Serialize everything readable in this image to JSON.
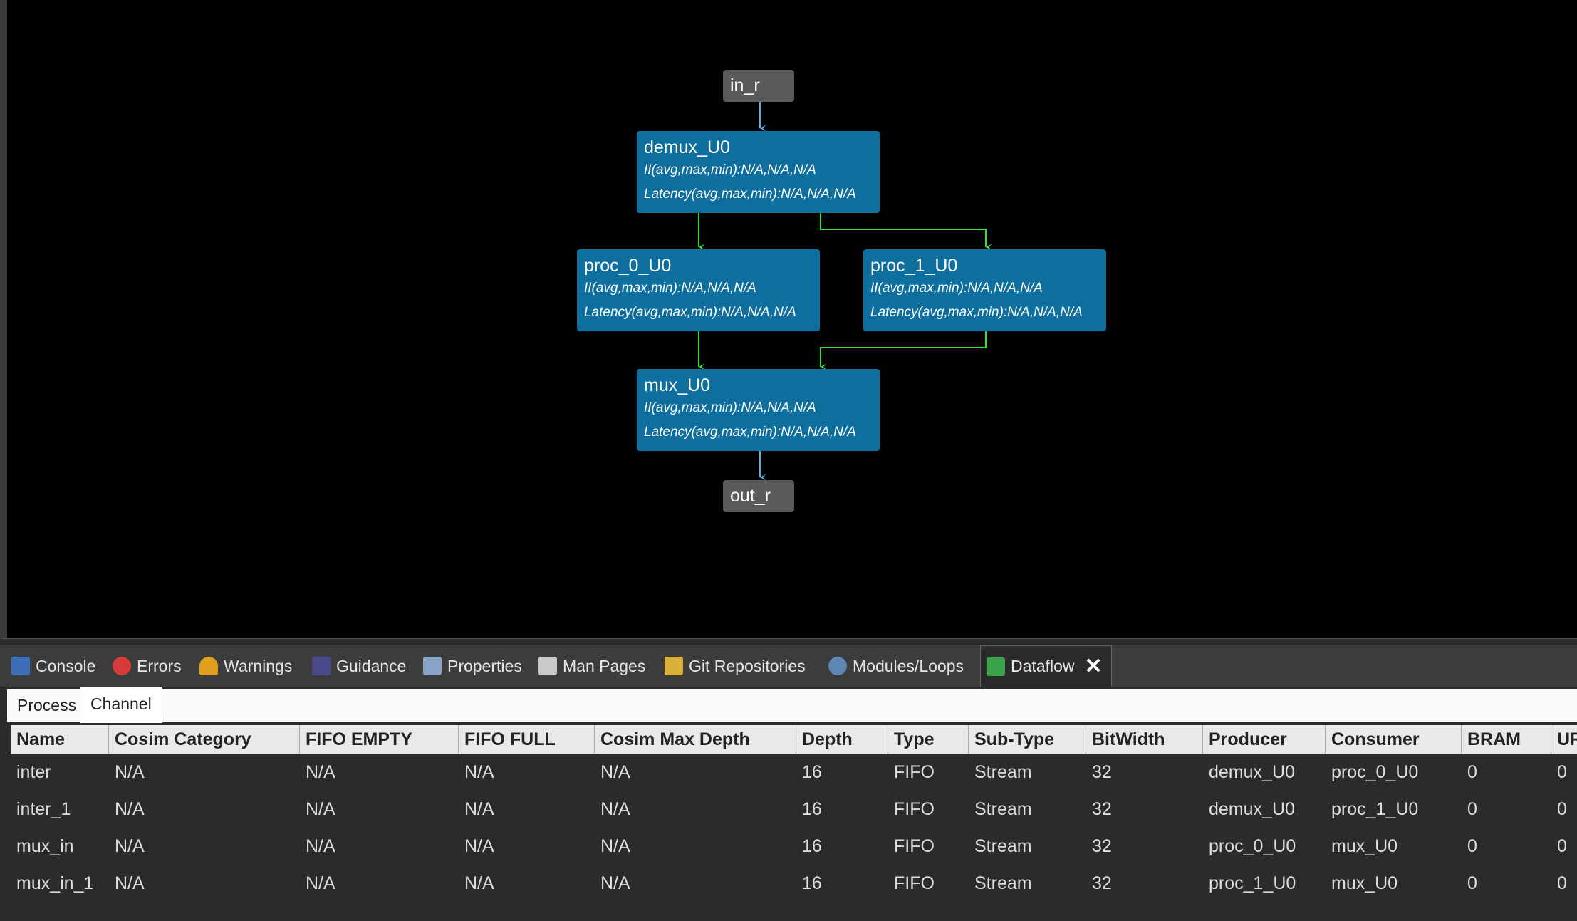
{
  "graph": {
    "ports": {
      "input": "in_r",
      "output": "out_r"
    },
    "nodes": [
      {
        "name": "demux_U0",
        "ii": "II(avg,max,min):N/A,N/A,N/A",
        "latency": "Latency(avg,max,min):N/A,N/A,N/A"
      },
      {
        "name": "proc_0_U0",
        "ii": "II(avg,max,min):N/A,N/A,N/A",
        "latency": "Latency(avg,max,min):N/A,N/A,N/A"
      },
      {
        "name": "proc_1_U0",
        "ii": "II(avg,max,min):N/A,N/A,N/A",
        "latency": "Latency(avg,max,min):N/A,N/A,N/A"
      },
      {
        "name": "mux_U0",
        "ii": "II(avg,max,min):N/A,N/A,N/A",
        "latency": "Latency(avg,max,min):N/A,N/A,N/A"
      }
    ],
    "colors": {
      "node": "#0e6f9e",
      "port": "#5a5a5a",
      "port_edge": "#5bb0e8",
      "channel_edge": "#2ee62e"
    }
  },
  "view_tabs": [
    {
      "label": "Console",
      "icon": "console-icon"
    },
    {
      "label": "Errors",
      "icon": "errors-icon"
    },
    {
      "label": "Warnings",
      "icon": "warnings-icon"
    },
    {
      "label": "Guidance",
      "icon": "guidance-icon"
    },
    {
      "label": "Properties",
      "icon": "properties-icon"
    },
    {
      "label": "Man Pages",
      "icon": "man-pages-icon"
    },
    {
      "label": "Git Repositories",
      "icon": "git-icon"
    },
    {
      "label": "Modules/Loops",
      "icon": "modules-icon"
    },
    {
      "label": "Dataflow",
      "icon": "dataflow-icon",
      "active": true
    }
  ],
  "sub_tabs": [
    "Process",
    "Channel"
  ],
  "table": {
    "columns": [
      "Name",
      "Cosim Category",
      "FIFO EMPTY",
      "FIFO FULL",
      "Cosim Max Depth",
      "Depth",
      "Type",
      "Sub-Type",
      "BitWidth",
      "Producer",
      "Consumer",
      "BRAM",
      "UR"
    ],
    "rows": [
      [
        "inter",
        "N/A",
        "N/A",
        "N/A",
        "N/A",
        "16",
        "FIFO",
        "Stream",
        "32",
        "demux_U0",
        "proc_0_U0",
        "0",
        "0"
      ],
      [
        "inter_1",
        "N/A",
        "N/A",
        "N/A",
        "N/A",
        "16",
        "FIFO",
        "Stream",
        "32",
        "demux_U0",
        "proc_1_U0",
        "0",
        "0"
      ],
      [
        "mux_in",
        "N/A",
        "N/A",
        "N/A",
        "N/A",
        "16",
        "FIFO",
        "Stream",
        "32",
        "proc_0_U0",
        "mux_U0",
        "0",
        "0"
      ],
      [
        "mux_in_1",
        "N/A",
        "N/A",
        "N/A",
        "N/A",
        "16",
        "FIFO",
        "Stream",
        "32",
        "proc_1_U0",
        "mux_U0",
        "0",
        "0"
      ]
    ]
  }
}
